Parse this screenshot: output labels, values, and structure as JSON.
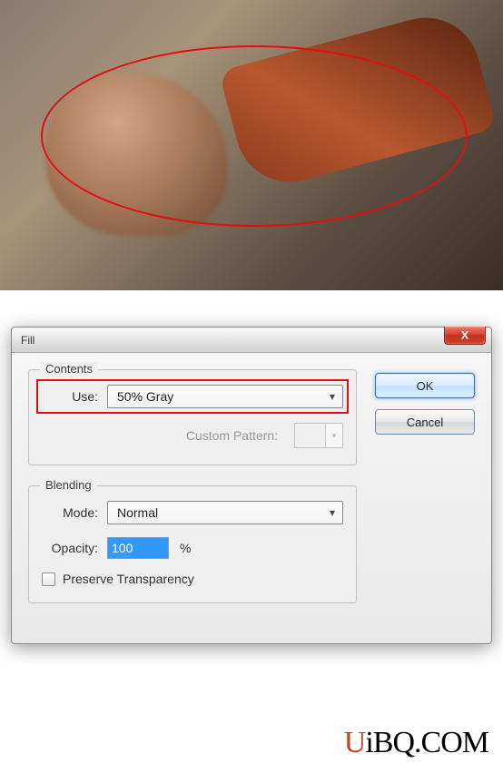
{
  "image": {
    "ellipse_color": "#e01010",
    "watermark": ""
  },
  "dialog": {
    "title": "Fill",
    "close_glyph": "X",
    "contents": {
      "legend": "Contents",
      "use_label": "Use:",
      "use_value": "50% Gray",
      "custom_pattern_label": "Custom Pattern:"
    },
    "blending": {
      "legend": "Blending",
      "mode_label": "Mode:",
      "mode_value": "Normal",
      "opacity_label": "Opacity:",
      "opacity_value": "100",
      "opacity_suffix": "%",
      "preserve_label": "Preserve Transparency",
      "preserve_checked": false
    },
    "buttons": {
      "ok": "OK",
      "cancel": "Cancel"
    }
  },
  "footer": {
    "logo_u": "U",
    "logo_rest": "iBQ.COM"
  }
}
